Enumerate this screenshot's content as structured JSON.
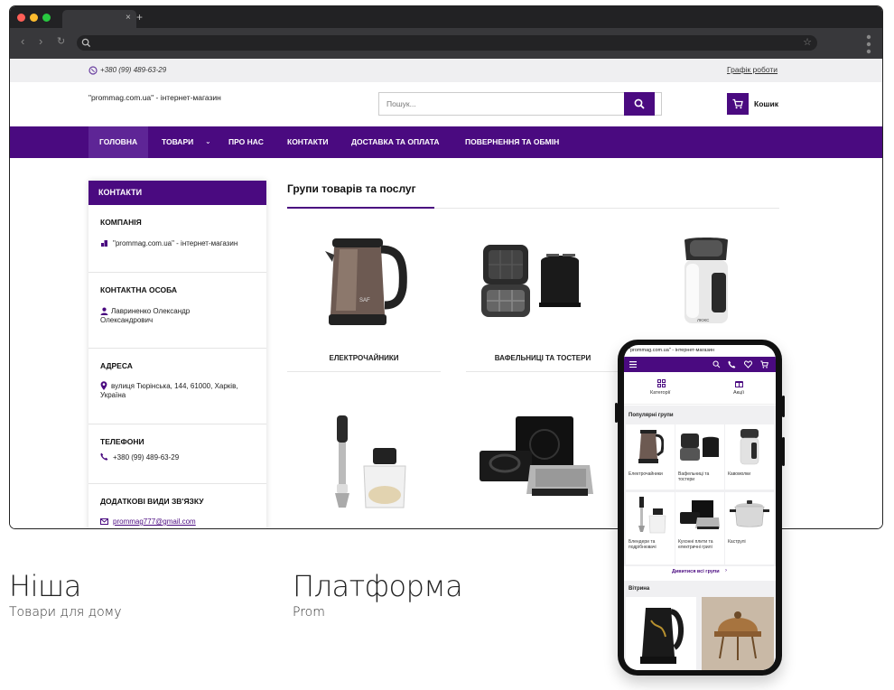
{
  "browser": {
    "tab_close": "×",
    "tab_new": "+"
  },
  "site": {
    "phone": "+380 (99) 489-63-29",
    "schedule_link": "Графік роботи",
    "logo_text": "\"prommag.com.ua\" - інтернет-магазин",
    "search_placeholder": "Пошук...",
    "cart_label": "Кошик",
    "nav": [
      "ГОЛОВНА",
      "ТОВАРИ",
      "ПРО НАС",
      "КОНТАКТИ",
      "ДОСТАВКА ТА ОПЛАТА",
      "ПОВЕРНЕННЯ ТА ОБМІН"
    ],
    "colors": {
      "brand": "#4a0a80",
      "active_nav": "#5e2596"
    }
  },
  "sidebar": {
    "title": "КОНТАКТИ",
    "company_title": "КОМПАНІЯ",
    "company_value": "\"prommag.com.ua\" - інтернет-магазин",
    "person_title": "КОНТАКТНА ОСОБА",
    "person_value": "Лавриненко Олександр Олександрович",
    "address_title": "АДРЕСА",
    "address_value": "вулиця Тюрінська, 144, 61000, Харків, Україна",
    "phones_title": "ТЕЛЕФОНИ",
    "phones_value": "+380 (99) 489-63-29",
    "other_title": "ДОДАТКОВІ ВИДИ ЗВ'ЯЗКУ",
    "email": "prommag777@gmail.com"
  },
  "content": {
    "section_title": "Групи товарів та послуг",
    "products": [
      "ЕЛЕКТРОЧАЙНИКИ",
      "ВАФЕЛЬНИЦІ ТА ТОСТЕРИ"
    ]
  },
  "mobile": {
    "top_text": "\"prommag.com.ua\" - інтернет-магазин",
    "categories_label": "Категорії",
    "promos_label": "Акції",
    "popular_title": "Популярні групи",
    "tiles": [
      "Електрочайники",
      "Вафельниці та тостери",
      "Кавомолки",
      "Блендери та подрібнювачі",
      "Кухонні плити та електричні грилі",
      "Каструлі"
    ],
    "see_all": "Дивитися всі групи",
    "showcase_title": "Вітрина"
  },
  "info": {
    "niche_title": "Ніша",
    "niche_value": "Товари для дому",
    "platform_title": "Платформа",
    "platform_value": "Prom"
  }
}
